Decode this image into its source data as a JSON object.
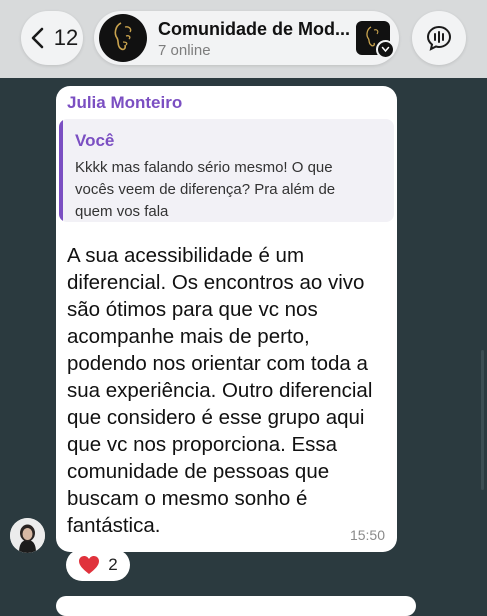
{
  "header": {
    "back_count": "12",
    "group_title": "Comunidade de Mod...",
    "group_status": "7 online"
  },
  "message": {
    "sender": "Julia Monteiro",
    "quote": {
      "author": "Você",
      "text": "Kkkk mas falando sério mesmo! O que vocês veem de diferença? Pra além de quem vos fala"
    },
    "body": "A sua acessibilidade é um diferencial. Os encontros ao vivo são ótimos para que vc nos acompanhe mais de perto, podendo nos orientar com toda a sua experiência. Outro diferencial que considero é esse grupo aqui que vc nos proporciona. Essa comunidade de pessoas que buscam o mesmo sonho é fantástica.",
    "time": "15:50",
    "reaction": {
      "emoji": "heart-icon",
      "count": "2"
    }
  },
  "colors": {
    "chat_background": "#2b3a3f",
    "accent": "#7b4fc2",
    "header_bg": "#d8dadb",
    "reaction_heart": "#e0323c"
  }
}
